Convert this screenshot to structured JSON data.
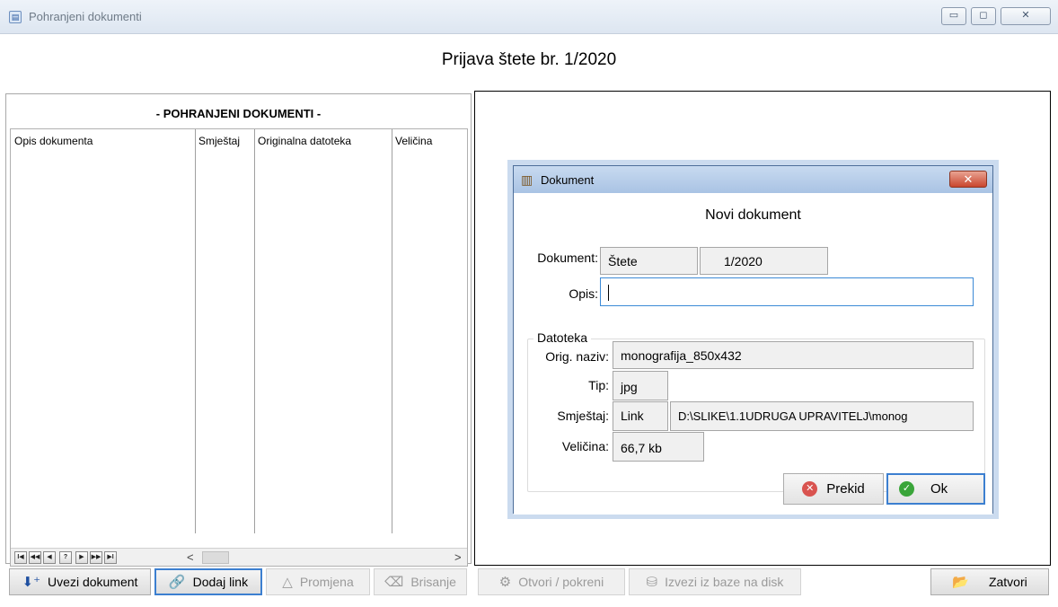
{
  "window": {
    "title": "Pohranjeni dokumenti",
    "controls": {
      "minimize": "▭",
      "maximize": "◻",
      "close": "✕"
    }
  },
  "form": {
    "heading": "Prijava štete br. 1/2020"
  },
  "left_panel": {
    "caption": "- POHRANJENI DOKUMENTI -",
    "columns": [
      "Opis dokumenta",
      "Smještaj",
      "Originalna datoteka",
      "Veličina"
    ],
    "nav_buttons": [
      "I◀",
      "◀◀",
      "◀",
      "?",
      "▶",
      "▶▶",
      "▶I"
    ],
    "scroll_left": "<",
    "scroll_right": ">"
  },
  "toolbar": {
    "uvezi": "Uvezi dokument",
    "dodaj_link": "Dodaj link",
    "promjena": "Promjena",
    "brisanje": "Brisanje",
    "otvori": "Otvori / pokreni",
    "izvezi": "Izvezi iz baze na disk",
    "zatvori": "Zatvori"
  },
  "dialog": {
    "title": "Dokument",
    "close": "✕",
    "heading": "Novi dokument",
    "dokument_label": "Dokument:",
    "dokument_type": "Štete",
    "dokument_number": "1/2020",
    "opis_label": "Opis:",
    "opis_value": "",
    "group_title": "Datoteka",
    "orig_label": "Orig. naziv:",
    "orig_value": "monografija_850x432",
    "tip_label": "Tip:",
    "tip_value": "jpg",
    "smjestaj_label": "Smještaj:",
    "smjestaj_value": "Link",
    "path_value": "D:\\SLIKE\\1.1UDRUGA UPRAVITELJ\\monog",
    "velicina_label": "Veličina:",
    "velicina_value": "66,7 kb",
    "prekid": "Prekid",
    "ok": "Ok"
  },
  "colors": {
    "focus_blue": "#3c7fd0",
    "cancel_red": "#d9534f",
    "ok_green": "#3aa53a"
  }
}
